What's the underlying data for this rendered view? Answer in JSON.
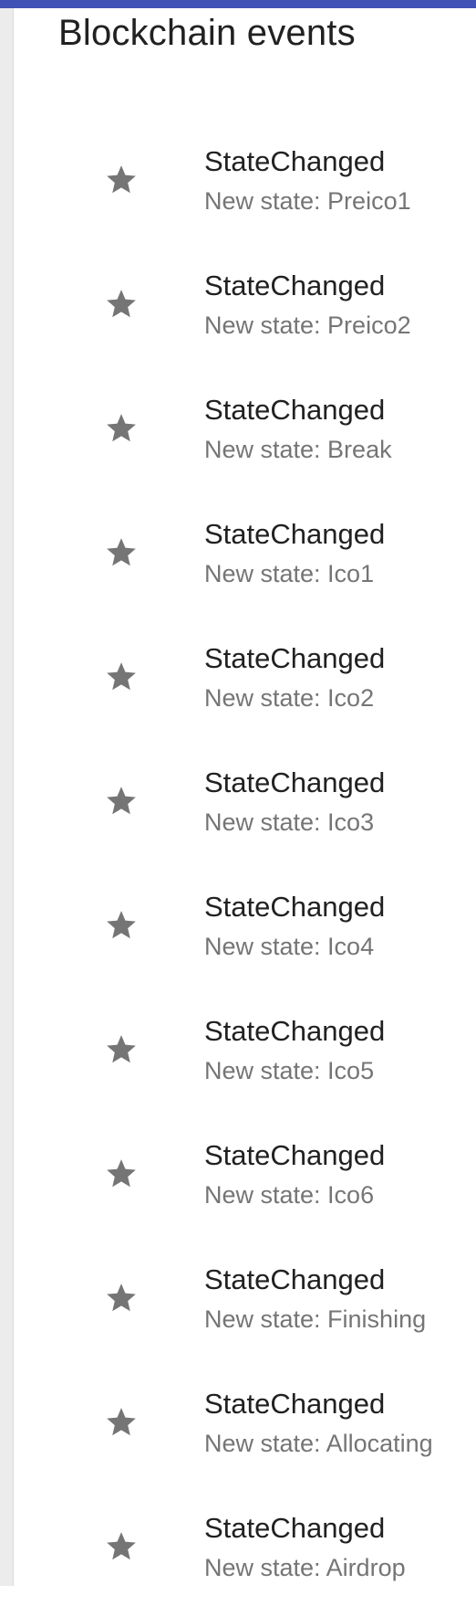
{
  "header": {
    "title": "Blockchain events"
  },
  "colors": {
    "app_bar": "#4052b5",
    "icon": "#757575",
    "primary_text": "#212121",
    "secondary_text": "#757575"
  },
  "events": [
    {
      "name": "StateChanged",
      "description": "New state: Preico1",
      "icon": "star-icon"
    },
    {
      "name": "StateChanged",
      "description": "New state: Preico2",
      "icon": "star-icon"
    },
    {
      "name": "StateChanged",
      "description": "New state: Break",
      "icon": "star-icon"
    },
    {
      "name": "StateChanged",
      "description": "New state: Ico1",
      "icon": "star-icon"
    },
    {
      "name": "StateChanged",
      "description": "New state: Ico2",
      "icon": "star-icon"
    },
    {
      "name": "StateChanged",
      "description": "New state: Ico3",
      "icon": "star-icon"
    },
    {
      "name": "StateChanged",
      "description": "New state: Ico4",
      "icon": "star-icon"
    },
    {
      "name": "StateChanged",
      "description": "New state: Ico5",
      "icon": "star-icon"
    },
    {
      "name": "StateChanged",
      "description": "New state: Ico6",
      "icon": "star-icon"
    },
    {
      "name": "StateChanged",
      "description": "New state: Finishing",
      "icon": "star-icon"
    },
    {
      "name": "StateChanged",
      "description": "New state: Allocating",
      "icon": "star-icon"
    },
    {
      "name": "StateChanged",
      "description": "New state: Airdrop",
      "icon": "star-icon"
    }
  ]
}
